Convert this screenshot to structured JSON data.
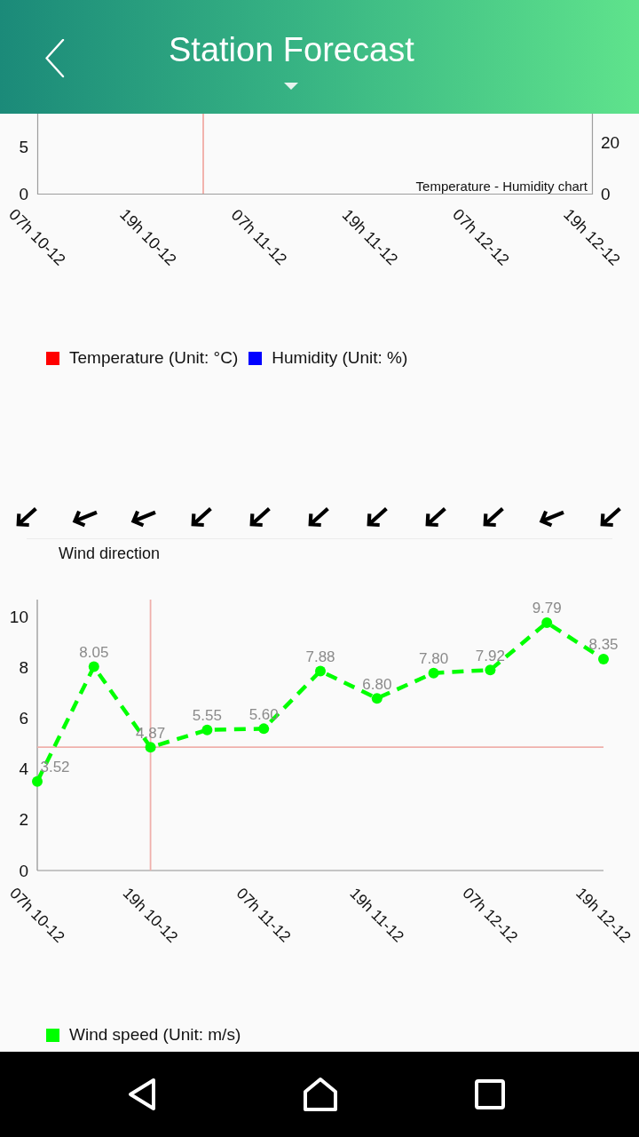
{
  "header": {
    "title": "Station Forecast"
  },
  "temperature_humidity_chart": {
    "caption": "Temperature - Humidity chart",
    "left_axis_ticks": [
      "5",
      "0"
    ],
    "right_axis_ticks": [
      "20",
      "0"
    ],
    "x_labels": [
      "07h 10-12",
      "19h 10-12",
      "07h 11-12",
      "19h 11-12",
      "07h 12-12",
      "19h 12-12"
    ],
    "legend": [
      {
        "label": "Temperature (Unit: °C)",
        "color": "#ff0000"
      },
      {
        "label": "Humidity (Unit: %)",
        "color": "#0000ff"
      }
    ]
  },
  "wind_direction": {
    "arrows": [
      {
        "kind": "sw"
      },
      {
        "kind": "wsw"
      },
      {
        "kind": "wsw"
      },
      {
        "kind": "sw"
      },
      {
        "kind": "sw"
      },
      {
        "kind": "sw"
      },
      {
        "kind": "sw"
      },
      {
        "kind": "sw"
      },
      {
        "kind": "sw"
      },
      {
        "kind": "wsw"
      },
      {
        "kind": "sw"
      }
    ],
    "label": "Wind direction"
  },
  "wind_speed_chart": {
    "chart_data": {
      "type": "line",
      "categories": [
        "07h 10-12",
        null,
        "19h 10-12",
        null,
        "07h 11-12",
        null,
        "19h 11-12",
        null,
        "07h 12-12",
        null,
        "19h 12-12"
      ],
      "ylim": [
        0,
        10.7
      ],
      "yticks": [
        0,
        2,
        4,
        6,
        8,
        10
      ],
      "series": [
        {
          "name": "Wind speed (Unit: m/s)",
          "color": "#00ff00",
          "line_style": "dashed",
          "marker": "circle",
          "values": [
            3.52,
            8.05,
            4.87,
            5.55,
            5.6,
            7.88,
            6.8,
            7.8,
            7.92,
            9.79,
            8.35
          ]
        }
      ],
      "value_labels": [
        "3.52",
        "8.05",
        "4.87",
        "5.55",
        "5.60",
        "7.88",
        "6.80",
        "7.80",
        "7.92",
        "9.79",
        "8.35"
      ],
      "ref_lines": [
        {
          "axis": "x",
          "value": "19h 10-12"
        },
        {
          "axis": "y",
          "value": 4.87
        }
      ]
    }
  }
}
